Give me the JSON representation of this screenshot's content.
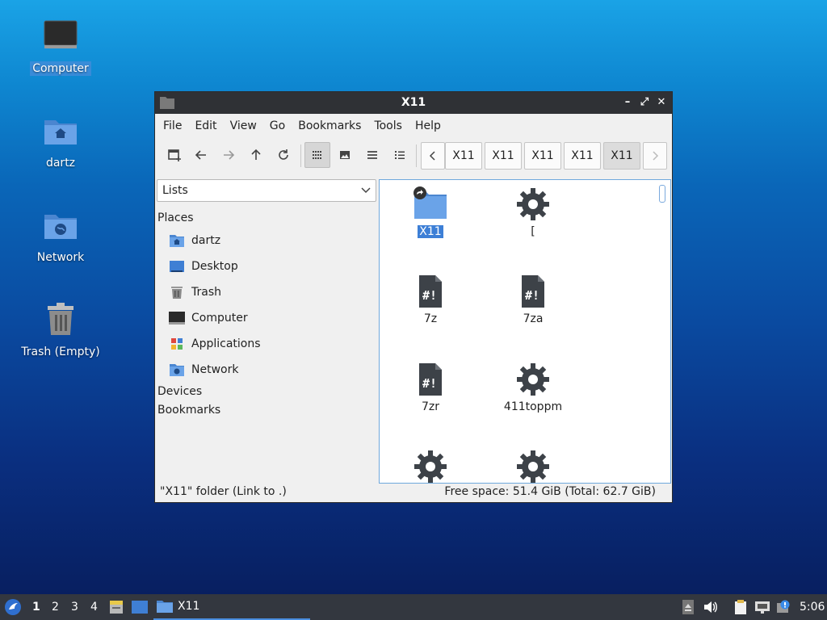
{
  "desktop": {
    "icons": [
      {
        "label": "Computer"
      },
      {
        "label": "dartz"
      },
      {
        "label": "Network"
      },
      {
        "label": "Trash (Empty)"
      }
    ]
  },
  "window": {
    "title": "X11",
    "controls": {
      "minimize": "–",
      "maximize": "⤢",
      "close": "✕"
    }
  },
  "menu": [
    "File",
    "Edit",
    "View",
    "Go",
    "Bookmarks",
    "Tools",
    "Help"
  ],
  "breadcrumbs": [
    "X11",
    "X11",
    "X11",
    "X11",
    "X11"
  ],
  "sidepane": {
    "mode": "Lists",
    "places_header": "Places",
    "places": [
      {
        "label": "dartz"
      },
      {
        "label": "Desktop"
      },
      {
        "label": "Trash"
      },
      {
        "label": "Computer"
      },
      {
        "label": "Applications"
      },
      {
        "label": "Network"
      }
    ],
    "devices_header": "Devices",
    "bookmarks_header": "Bookmarks"
  },
  "files": [
    {
      "name": "X11",
      "kind": "folder-link",
      "selected": true
    },
    {
      "name": "[",
      "kind": "executable"
    },
    {
      "name": "7z",
      "kind": "script"
    },
    {
      "name": "7za",
      "kind": "script"
    },
    {
      "name": "7zr",
      "kind": "script"
    },
    {
      "name": "411toppm",
      "kind": "executable"
    },
    {
      "name": "",
      "kind": "executable"
    },
    {
      "name": "",
      "kind": "executable"
    }
  ],
  "status": {
    "left": "\"X11\" folder (Link to .)",
    "right": "Free space: 51.4 GiB (Total: 62.7 GiB)"
  },
  "taskbar": {
    "workspaces": [
      "1",
      "2",
      "3",
      "4"
    ],
    "task_label": "X11",
    "clock": "5:06"
  },
  "colors": {
    "accent": "#3d7fd6",
    "folder": "#5b97e0",
    "titlebar": "#2f3135",
    "taskbar": "#33373f"
  }
}
